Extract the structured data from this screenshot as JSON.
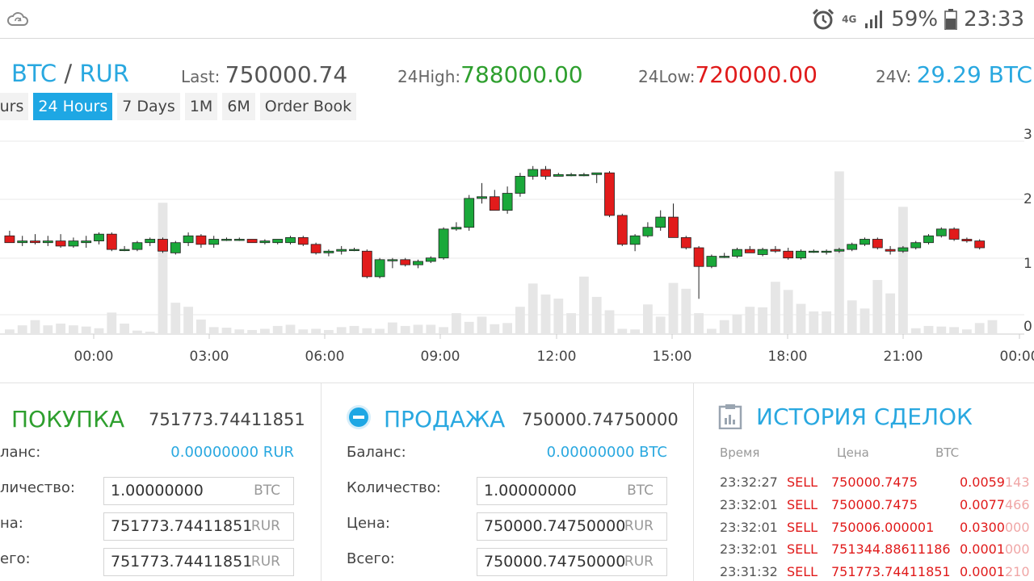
{
  "status_bar": {
    "battery": "59%",
    "time": "23:33",
    "network": "4G",
    "icons": [
      "cloud-sync-icon",
      "alarm-icon",
      "signal-icon",
      "battery-icon"
    ]
  },
  "ticker": {
    "pair_base": "BTC",
    "pair_sep": "/",
    "pair_quote": "RUR",
    "last_label": "Last:",
    "last_value": "750000.74",
    "high_label": "24High:",
    "high_value": "788000.00",
    "low_label": "24Low:",
    "low_value": "720000.00",
    "vol_label": "24V:",
    "vol_value": "29.29 BTC"
  },
  "tabs": [
    {
      "label": "ours",
      "active": false
    },
    {
      "label": "24 Hours",
      "active": true
    },
    {
      "label": "7 Days",
      "active": false
    },
    {
      "label": "1M",
      "active": false
    },
    {
      "label": "6M",
      "active": false
    },
    {
      "label": "Order Book",
      "active": false
    }
  ],
  "colors": {
    "accent": "#1ea7e4",
    "up": "#1aa83a",
    "down": "#e21b1b",
    "volume": "#e6e6e6"
  },
  "chart_data": {
    "type": "candlestick",
    "x_ticks": [
      "00:00",
      "03:00",
      "06:00",
      "09:00",
      "12:00",
      "15:00",
      "18:00",
      "21:00",
      "00:00"
    ],
    "y_ticks_right": [
      "3",
      "2",
      "1",
      "0"
    ],
    "grid": true,
    "candles": [
      {
        "o": 749500,
        "h": 751000,
        "l": 747500,
        "c": 747500
      },
      {
        "o": 747500,
        "h": 749500,
        "l": 746500,
        "c": 748000
      },
      {
        "o": 748000,
        "h": 750000,
        "l": 747000,
        "c": 747500
      },
      {
        "o": 747500,
        "h": 749500,
        "l": 746500,
        "c": 748000
      },
      {
        "o": 748000,
        "h": 750000,
        "l": 746000,
        "c": 746500
      },
      {
        "o": 746500,
        "h": 749000,
        "l": 746000,
        "c": 748000
      },
      {
        "o": 747500,
        "h": 749500,
        "l": 746000,
        "c": 748000
      },
      {
        "o": 748000,
        "h": 750500,
        "l": 747000,
        "c": 750000
      },
      {
        "o": 750000,
        "h": 750500,
        "l": 745000,
        "c": 745500
      },
      {
        "o": 745500,
        "h": 746500,
        "l": 745000,
        "c": 745500
      },
      {
        "o": 745500,
        "h": 748000,
        "l": 745000,
        "c": 747500
      },
      {
        "o": 747500,
        "h": 749000,
        "l": 746500,
        "c": 748500
      },
      {
        "o": 748500,
        "h": 749000,
        "l": 744500,
        "c": 745000
      },
      {
        "o": 744500,
        "h": 748000,
        "l": 744000,
        "c": 747500
      },
      {
        "o": 747500,
        "h": 750500,
        "l": 746500,
        "c": 749500
      },
      {
        "o": 749500,
        "h": 750000,
        "l": 746000,
        "c": 747000
      },
      {
        "o": 747000,
        "h": 749500,
        "l": 746000,
        "c": 748500
      },
      {
        "o": 748500,
        "h": 749000,
        "l": 748000,
        "c": 748500
      },
      {
        "o": 748500,
        "h": 749000,
        "l": 748000,
        "c": 748500
      },
      {
        "o": 748500,
        "h": 748500,
        "l": 747500,
        "c": 747500
      },
      {
        "o": 747500,
        "h": 748500,
        "l": 747000,
        "c": 748000
      },
      {
        "o": 747500,
        "h": 748500,
        "l": 747000,
        "c": 748500
      },
      {
        "o": 747500,
        "h": 749500,
        "l": 747000,
        "c": 749000
      },
      {
        "o": 749000,
        "h": 749500,
        "l": 746500,
        "c": 747000
      },
      {
        "o": 747000,
        "h": 747500,
        "l": 744000,
        "c": 744500
      },
      {
        "o": 744500,
        "h": 745500,
        "l": 743500,
        "c": 745000
      },
      {
        "o": 745000,
        "h": 746500,
        "l": 744000,
        "c": 745500
      },
      {
        "o": 745500,
        "h": 746000,
        "l": 745000,
        "c": 745500
      },
      {
        "o": 745000,
        "h": 745500,
        "l": 737000,
        "c": 737500
      },
      {
        "o": 737500,
        "h": 743000,
        "l": 737000,
        "c": 742500
      },
      {
        "o": 742500,
        "h": 743000,
        "l": 740000,
        "c": 742500
      },
      {
        "o": 742500,
        "h": 743000,
        "l": 740500,
        "c": 741000
      },
      {
        "o": 741000,
        "h": 742500,
        "l": 740000,
        "c": 742000
      },
      {
        "o": 742000,
        "h": 743500,
        "l": 741500,
        "c": 743000
      },
      {
        "o": 743000,
        "h": 752000,
        "l": 742500,
        "c": 751500
      },
      {
        "o": 751500,
        "h": 753500,
        "l": 751000,
        "c": 752000
      },
      {
        "o": 752000,
        "h": 761500,
        "l": 751000,
        "c": 760500
      },
      {
        "o": 760500,
        "h": 765000,
        "l": 759000,
        "c": 761000
      },
      {
        "o": 761000,
        "h": 763000,
        "l": 757000,
        "c": 757000
      },
      {
        "o": 757000,
        "h": 764000,
        "l": 756000,
        "c": 762000
      },
      {
        "o": 762000,
        "h": 768000,
        "l": 761000,
        "c": 767000
      },
      {
        "o": 767000,
        "h": 770000,
        "l": 766000,
        "c": 769000
      },
      {
        "o": 769000,
        "h": 770000,
        "l": 766000,
        "c": 767000
      },
      {
        "o": 767000,
        "h": 768000,
        "l": 767000,
        "c": 767500
      },
      {
        "o": 767500,
        "h": 768000,
        "l": 767000,
        "c": 767500
      },
      {
        "o": 767500,
        "h": 768000,
        "l": 767000,
        "c": 767500
      },
      {
        "o": 767500,
        "h": 768000,
        "l": 765000,
        "c": 768000
      },
      {
        "o": 768000,
        "h": 768500,
        "l": 755000,
        "c": 755500
      },
      {
        "o": 755500,
        "h": 756000,
        "l": 746500,
        "c": 747000
      },
      {
        "o": 747000,
        "h": 750000,
        "l": 745000,
        "c": 749500
      },
      {
        "o": 749500,
        "h": 753500,
        "l": 749000,
        "c": 752000
      },
      {
        "o": 752000,
        "h": 757000,
        "l": 751000,
        "c": 755000
      },
      {
        "o": 755000,
        "h": 759000,
        "l": 749000,
        "c": 749000
      },
      {
        "o": 749000,
        "h": 749500,
        "l": 745500,
        "c": 746000
      },
      {
        "o": 746000,
        "h": 746500,
        "l": 731000,
        "c": 740500
      },
      {
        "o": 740500,
        "h": 744000,
        "l": 740000,
        "c": 743500
      },
      {
        "o": 743500,
        "h": 744500,
        "l": 743000,
        "c": 743500
      },
      {
        "o": 743500,
        "h": 746000,
        "l": 743000,
        "c": 745500
      },
      {
        "o": 745500,
        "h": 746500,
        "l": 744500,
        "c": 744500
      },
      {
        "o": 744000,
        "h": 746000,
        "l": 743500,
        "c": 745500
      },
      {
        "o": 745500,
        "h": 746500,
        "l": 744500,
        "c": 745000
      },
      {
        "o": 745000,
        "h": 746000,
        "l": 742500,
        "c": 743000
      },
      {
        "o": 743000,
        "h": 745500,
        "l": 742500,
        "c": 745000
      },
      {
        "o": 745000,
        "h": 745500,
        "l": 744500,
        "c": 745000
      },
      {
        "o": 745000,
        "h": 745500,
        "l": 744000,
        "c": 745000
      },
      {
        "o": 745000,
        "h": 746000,
        "l": 744500,
        "c": 745500
      },
      {
        "o": 745500,
        "h": 747500,
        "l": 745000,
        "c": 747000
      },
      {
        "o": 747000,
        "h": 749000,
        "l": 746500,
        "c": 748500
      },
      {
        "o": 748500,
        "h": 749000,
        "l": 745500,
        "c": 746000
      },
      {
        "o": 745500,
        "h": 746500,
        "l": 744000,
        "c": 745000
      },
      {
        "o": 745000,
        "h": 746500,
        "l": 744500,
        "c": 746000
      },
      {
        "o": 746000,
        "h": 748000,
        "l": 745500,
        "c": 747500
      },
      {
        "o": 747500,
        "h": 750000,
        "l": 747000,
        "c": 749500
      },
      {
        "o": 749500,
        "h": 752000,
        "l": 749000,
        "c": 751500
      },
      {
        "o": 751500,
        "h": 752000,
        "l": 748000,
        "c": 748500
      },
      {
        "o": 748500,
        "h": 749000,
        "l": 747500,
        "c": 748000
      },
      {
        "o": 748000,
        "h": 748500,
        "l": 745500,
        "c": 746000
      }
    ],
    "volumes": [
      0.08,
      0.15,
      0.24,
      0.15,
      0.18,
      0.15,
      0.13,
      0.1,
      0.37,
      0.18,
      0.06,
      0.04,
      2.26,
      0.54,
      0.47,
      0.25,
      0.12,
      0.11,
      0.08,
      0.07,
      0.09,
      0.14,
      0.16,
      0.08,
      0.09,
      0.07,
      0.12,
      0.14,
      0.1,
      0.09,
      0.2,
      0.14,
      0.16,
      0.16,
      0.12,
      0.36,
      0.21,
      0.3,
      0.17,
      0.19,
      0.47,
      0.87,
      0.68,
      0.61,
      0.36,
      0.99,
      0.64,
      0.41,
      0.09,
      0.08,
      0.51,
      0.3,
      0.88,
      0.78,
      0.36,
      0.09,
      0.24,
      0.34,
      0.47,
      0.46,
      0.9,
      0.76,
      0.52,
      0.39,
      0.39,
      2.8,
      0.58,
      0.44,
      0.93,
      0.7,
      2.19,
      0.1,
      0.14,
      0.13,
      0.12,
      0.08,
      0.19,
      0.24
    ]
  },
  "buy": {
    "title": "ПОКУПКА",
    "price": "751773.74411851",
    "balance_label": "ланс:",
    "balance_value": "0.00000000 RUR",
    "qty_label": "личество:",
    "qty_value": "1.00000000",
    "qty_unit": "BTC",
    "price_label": "на:",
    "price_value": "751773.74411851",
    "price_unit": "RUR",
    "total_label": "его:",
    "total_value": "751773.74411851",
    "total_unit": "RUR"
  },
  "sell": {
    "title": "ПРОДАЖА",
    "price": "750000.74750000",
    "balance_label": "Баланс:",
    "balance_value": "0.00000000 BTC",
    "qty_label": "Количество:",
    "qty_value": "1.00000000",
    "qty_unit": "BTC",
    "price_label": "Цена:",
    "price_value": "750000.74750000",
    "price_unit": "RUR",
    "total_label": "Всего:",
    "total_value": "750000.74750000",
    "total_unit": "RUR"
  },
  "history": {
    "title": "ИСТОРИЯ СДЕЛОК",
    "col_time": "Время",
    "col_price": "Цена",
    "col_amount": "BTC",
    "rows": [
      {
        "time": "23:32:27",
        "type": "SELL",
        "price": "750000.7475",
        "amount_main": "0.0059",
        "amount_dim": "143"
      },
      {
        "time": "23:32:01",
        "type": "SELL",
        "price": "750000.7475",
        "amount_main": "0.0077",
        "amount_dim": "466"
      },
      {
        "time": "23:32:01",
        "type": "SELL",
        "price": "750006.000001",
        "amount_main": "0.0300",
        "amount_dim": "000"
      },
      {
        "time": "23:32:01",
        "type": "SELL",
        "price": "751344.88611186",
        "amount_main": "0.0001",
        "amount_dim": "000"
      },
      {
        "time": "23:31:32",
        "type": "SELL",
        "price": "751773.74411851",
        "amount_main": "0.0001",
        "amount_dim": "210"
      }
    ]
  }
}
